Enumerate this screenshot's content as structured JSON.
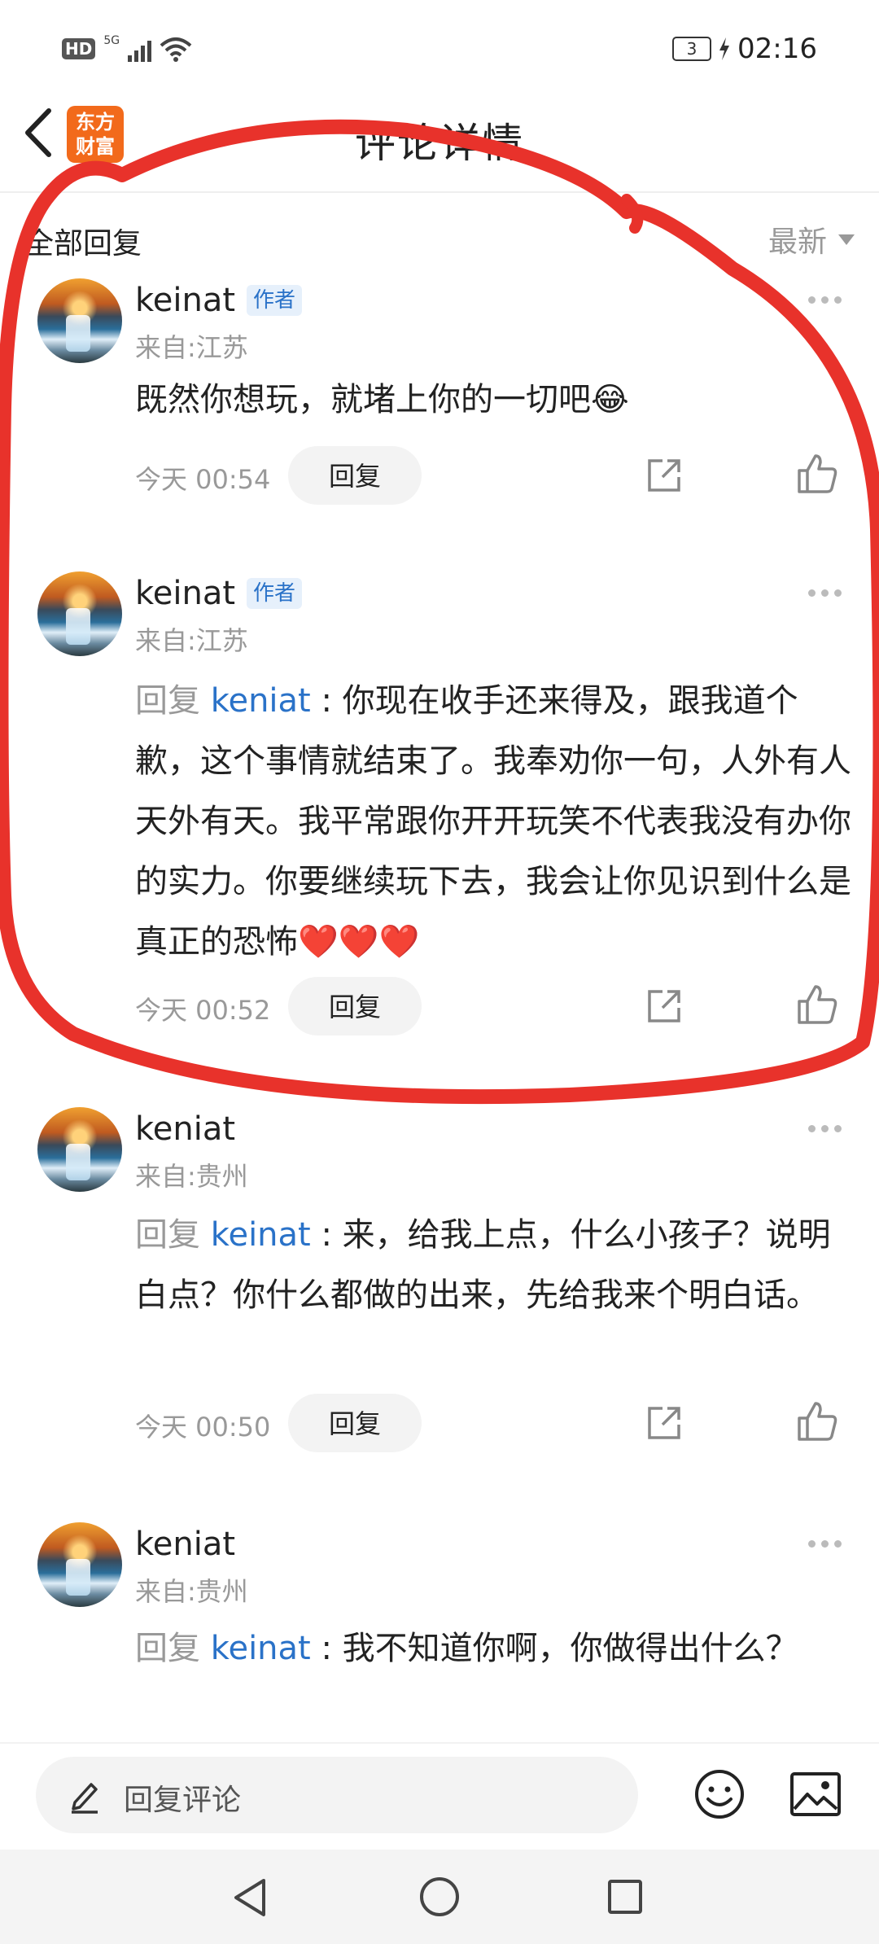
{
  "status_bar": {
    "network_badge": "HD",
    "network_type": "5G",
    "battery_level": "3",
    "time": "02:16"
  },
  "header": {
    "title": "评论详情",
    "app_logo_text": "东方财富"
  },
  "replies_section": {
    "title": "全部回复",
    "sort_label": "最新"
  },
  "comments": [
    {
      "username": "keinat",
      "badge": "作者",
      "location": "来自:江苏",
      "reply_prefix": "",
      "mention": "",
      "text": "既然你想玩，就堵上你的一切吧😂",
      "time": "今天 00:54",
      "reply_label": "回复"
    },
    {
      "username": "keinat",
      "badge": "作者",
      "location": "来自:江苏",
      "reply_prefix": "回复 ",
      "mention": "keniat",
      "text": " : 你现在收手还来得及，跟我道个歉，这个事情就结束了。我奉劝你一句，人外有人 天外有天。我平常跟你开开玩笑不代表我没有办你的实力。你要继续玩下去，我会让你见识到什么是真正的恐怖❤️❤️❤️",
      "time": "今天 00:52",
      "reply_label": "回复"
    },
    {
      "username": "keniat",
      "badge": "",
      "location": "来自:贵州",
      "reply_prefix": "回复 ",
      "mention": "keinat",
      "text": " : 来，给我上点，什么小孩子？说明白点？你什么都做的出来，先给我来个明白话。",
      "time": "今天 00:50",
      "reply_label": "回复"
    },
    {
      "username": "keniat",
      "badge": "",
      "location": "来自:贵州",
      "reply_prefix": "回复 ",
      "mention": "keinat",
      "text": " : 我不知道你啊，你做得出什么？",
      "time": "",
      "reply_label": ""
    }
  ],
  "input_bar": {
    "placeholder": "回复评论"
  },
  "colors": {
    "accent_blue": "#2a72c8",
    "annotation_red": "#e8322b",
    "logo_orange": "#f26a1b"
  }
}
